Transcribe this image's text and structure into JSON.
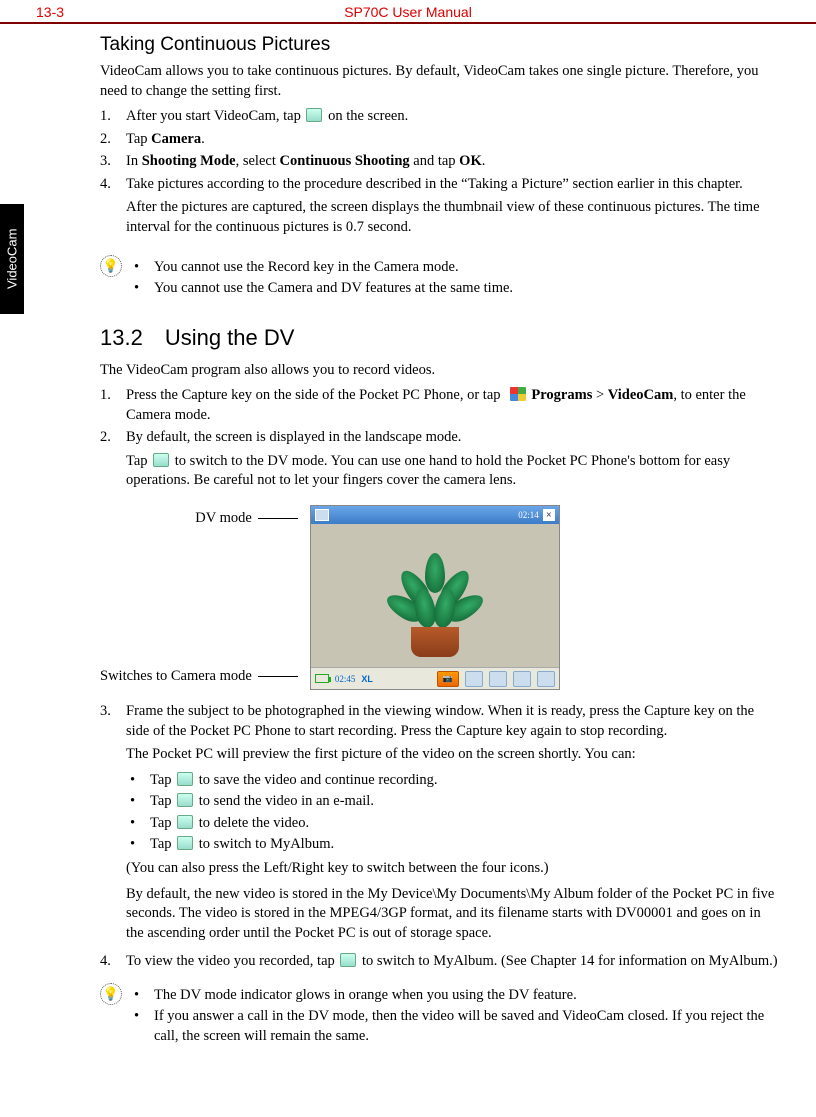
{
  "header": {
    "pagenum": "13-3",
    "title": "SP70C User Manual"
  },
  "sidebar_tab": "VideoCam",
  "s1": {
    "title": "Taking Continuous Pictures",
    "intro": "VideoCam allows you to take continuous pictures. By default, VideoCam takes one single picture. Therefore, you need to change the setting first.",
    "li1a": "After you start VideoCam, tap ",
    "li1b": " on the screen.",
    "li2a": "Tap ",
    "li2b": "Camera",
    "li2c": ".",
    "li3a": "In ",
    "li3b": "Shooting Mode",
    "li3c": ", select ",
    "li3d": "Continuous Shooting",
    "li3e": " and tap ",
    "li3f": "OK",
    "li3g": ".",
    "li4": "Take pictures according to the procedure described in the “Taking a Picture” section earlier in this chapter.",
    "li4b": "After the pictures are captured, the screen displays the thumbnail view of these continuous pictures. The time interval for the continuous pictures is 0.7 second.",
    "tip1": "You cannot use the Record key in the Camera mode.",
    "tip2": "You cannot use the Camera and DV features at the same time."
  },
  "s2": {
    "title": "13.2 Using the DV",
    "intro": "The VideoCam program also allows you to record videos.",
    "li1a": "Press the Capture key on the side of the Pocket PC Phone, or tap ",
    "li1b": " Programs",
    "li1c": " > ",
    "li1d": "VideoCam",
    "li1e": ", to enter the Camera mode.",
    "li2a": "By default, the screen is displayed in the landscape mode.",
    "li2b_a": "Tap ",
    "li2b_b": " to switch to the DV mode. You can use one hand to hold the Pocket PC Phone's bottom for easy operations. Be careful not to let your fingers cover the camera lens.",
    "fig_label_top": "DV mode",
    "fig_label_bot": "Switches to Camera mode",
    "screenshot": {
      "time": "02:14",
      "bottom_text": "02:45",
      "zoom": "XL"
    },
    "li3a": "Frame the subject to be photographed in the viewing window. When it is ready, press the Capture key on the side of the Pocket PC Phone to start recording. Press the Capture key again to stop recording.",
    "li3b": "The Pocket PC will preview the first picture of the video on the screen shortly. You can:",
    "b1a": "Tap ",
    "b1b": " to save the video and continue recording.",
    "b2a": "Tap ",
    "b2b": " to send the video in an e-mail.",
    "b3a": "Tap ",
    "b3b": " to delete the video.",
    "b4a": "Tap ",
    "b4b": " to switch to MyAlbum.",
    "li3c": "(You can also press the Left/Right key to switch between the four icons.)",
    "li3d": "By default, the new video is stored in the My Device\\My Documents\\My Album folder of the Pocket PC in five seconds. The video is stored in the MPEG4/3GP format, and its filename starts with DV00001 and goes on in the ascending order until the Pocket PC is out of storage space.",
    "li4a": "To view the video you recorded, tap ",
    "li4b": " to switch to MyAlbum. (See Chapter 14 for information on MyAlbum.)",
    "tip1": "The DV mode indicator glows in orange when you using the DV feature.",
    "tip2": "If you answer a call in the DV mode, then the video will be saved and VideoCam closed. If you reject the call, the screen will remain the same."
  },
  "nums": {
    "n1": "1.",
    "n2": "2.",
    "n3": "3.",
    "n4": "4."
  },
  "bullet": "•"
}
